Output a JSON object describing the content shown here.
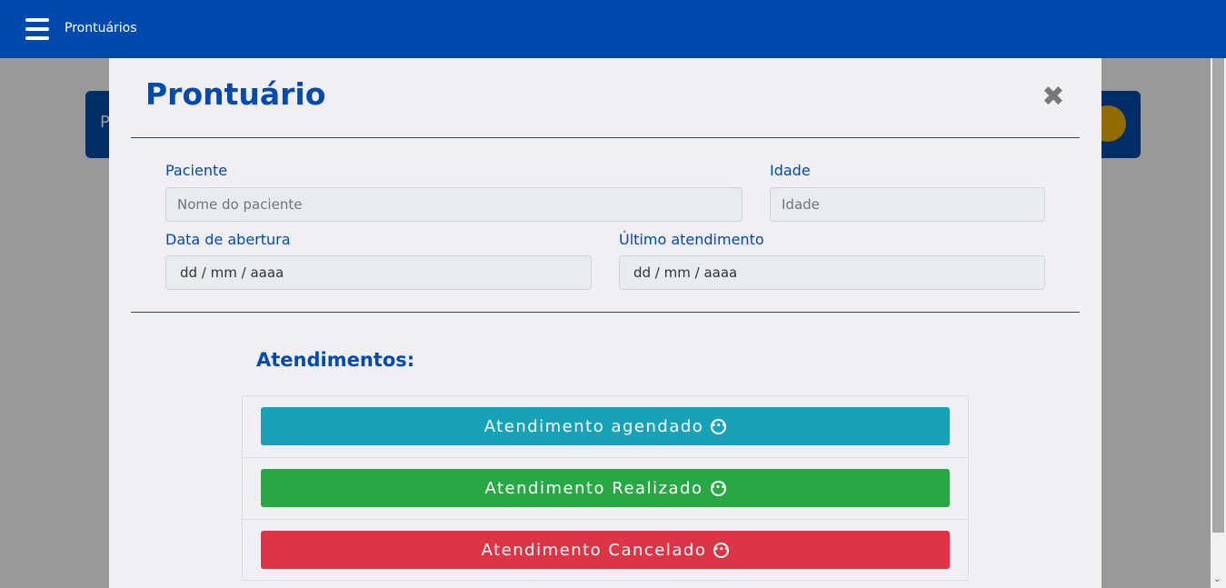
{
  "navbar": {
    "title": "Prontuários"
  },
  "background": {
    "card_letter": "P"
  },
  "modal": {
    "title": "Prontuário",
    "close_symbol": "✖",
    "fields": {
      "paciente_label": "Paciente",
      "paciente_placeholder": "Nome do paciente",
      "idade_label": "Idade",
      "idade_placeholder": "Idade",
      "abertura_label": "Data de abertura",
      "abertura_value": "dd / mm / aaaa",
      "ultimo_label": "Último atendimento",
      "ultimo_value": "dd / mm / aaaa"
    },
    "section_title": "Atendimentos:",
    "statuses": [
      {
        "label": "Atendimento agendado",
        "color": "#17a2b8",
        "icon": "more-circle-icon"
      },
      {
        "label": "Atendimento Realizado",
        "color": "#28a745",
        "icon": "more-circle-icon"
      },
      {
        "label": "Atendimento Cancelado",
        "color": "#dc3545",
        "icon": "more-circle-icon"
      }
    ]
  },
  "colors": {
    "primary": "#004aad",
    "modal_bg": "#f2eff4"
  }
}
